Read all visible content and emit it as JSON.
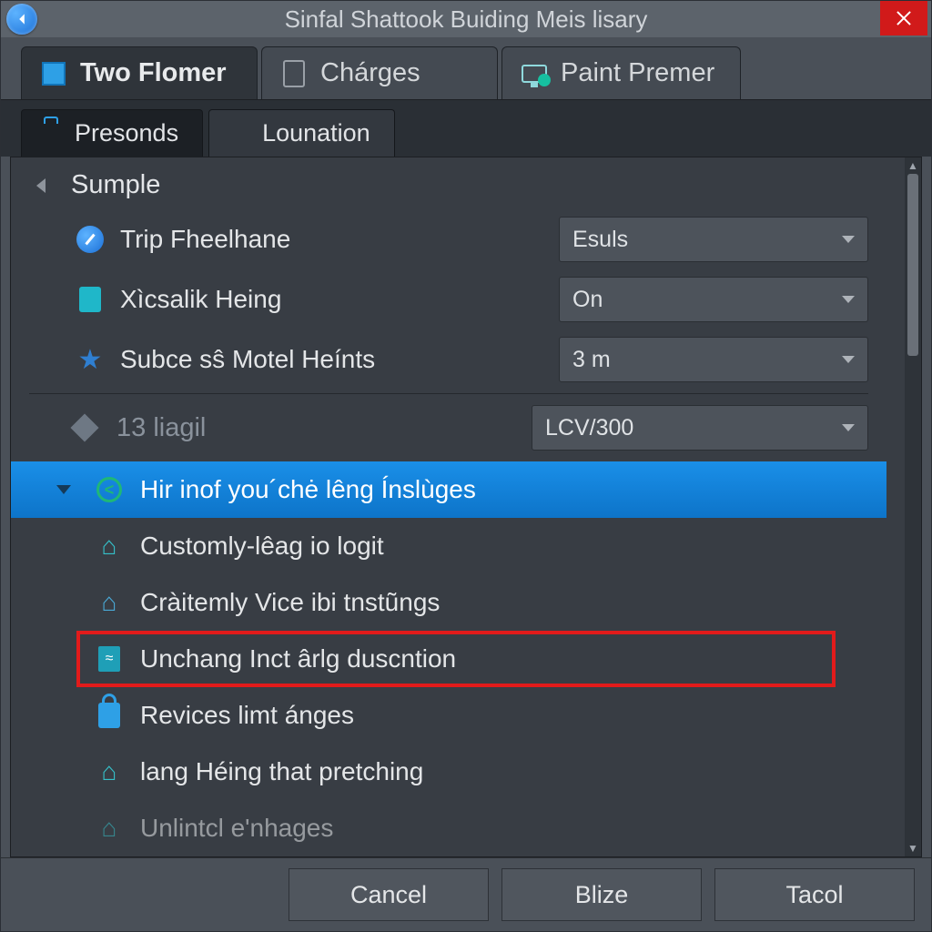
{
  "titlebar": {
    "title": "Sinfal Shattook Buiding Meis lisary"
  },
  "top_tabs": [
    {
      "label": "Two Flomer",
      "active": true
    },
    {
      "label": "Chárges",
      "active": false
    },
    {
      "label": "Paint Premer",
      "active": false
    }
  ],
  "sub_tabs": [
    {
      "label": "Presonds",
      "active": true
    },
    {
      "label": "Lounation",
      "active": false
    }
  ],
  "group": {
    "title": "Sumple"
  },
  "props": [
    {
      "label": "Trip Fheelhane",
      "value": "Esuls",
      "icon": "compass"
    },
    {
      "label": "Xìcsalik Heing",
      "value": "On",
      "icon": "trash"
    },
    {
      "label": "Subce sŝ Motel Heínts",
      "value": "3 m",
      "icon": "star"
    }
  ],
  "mid": {
    "label": "13 liagil",
    "value": "LCV/300"
  },
  "list": [
    {
      "label": "Hir inof you´chė lêng Ínslùges",
      "icon": "check",
      "selected": true
    },
    {
      "label": "Customly-lêag io logit",
      "icon": "house"
    },
    {
      "label": "Cràitemly Vice ibi tnstũngs",
      "icon": "house2"
    },
    {
      "label": "Unchang Inct ârlg duscntion",
      "icon": "doc",
      "boxed": true
    },
    {
      "label": "Revices limt ánges",
      "icon": "lock"
    },
    {
      "label": "lang Héing that pretching",
      "icon": "house"
    },
    {
      "label": "Unlintcl e'nhages",
      "icon": "house"
    }
  ],
  "footer": {
    "cancel": "Cancel",
    "blize": "Blize",
    "tacol": "Tacol"
  }
}
